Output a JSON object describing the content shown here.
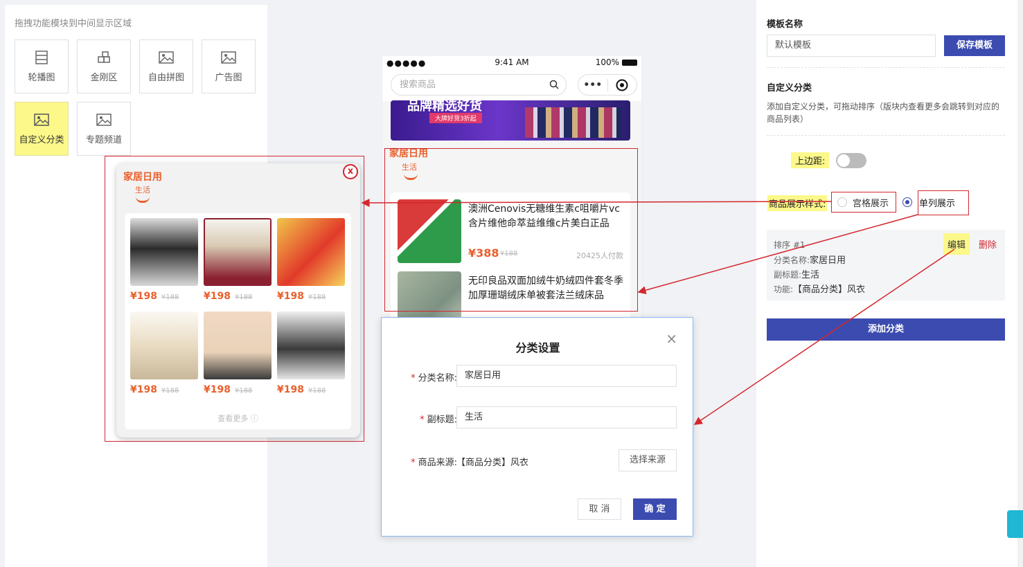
{
  "palette": {
    "hint": "拖拽功能模块到中间显示区域",
    "items": [
      {
        "label": "轮播图",
        "icon": "carousel-icon"
      },
      {
        "label": "金刚区",
        "icon": "grid-blocks-icon"
      },
      {
        "label": "自由拼图",
        "icon": "image-icon"
      },
      {
        "label": "广告图",
        "icon": "image-icon"
      },
      {
        "label": "自定义分类",
        "icon": "image-icon",
        "active": true
      },
      {
        "label": "专题频道",
        "icon": "image-icon"
      }
    ]
  },
  "phone": {
    "status": {
      "signal": "●●●●●",
      "time": "9:41 AM",
      "battery": "100%"
    },
    "search_placeholder": "搜索商品",
    "capsule_dots": "•••",
    "banner": {
      "title": "品牌精选好货",
      "subtitle": "大牌好货3折起"
    },
    "category": {
      "title": "家居日用",
      "subtitle": "生活"
    },
    "products": [
      {
        "name": "澳洲Cenovis无糖维生素c咀嚼片vc含片维他命萃益维维c片美白正品",
        "price": "¥388",
        "old_price": "¥188",
        "sold": "20425人付款"
      },
      {
        "name": "无印良品双面加绒牛奶绒四件套冬季加厚珊瑚绒床单被套法兰绒床品",
        "price": "",
        "old_price": "",
        "sold": ""
      }
    ]
  },
  "preview": {
    "title": "家居日用",
    "subtitle": "生活",
    "close": "x",
    "grid": [
      {
        "price": "¥198",
        "old": "¥188"
      },
      {
        "price": "¥198",
        "old": "¥188"
      },
      {
        "price": "¥198",
        "old": "¥188"
      },
      {
        "price": "¥198",
        "old": "¥188"
      },
      {
        "price": "¥198",
        "old": "¥188"
      },
      {
        "price": "¥198",
        "old": "¥188"
      }
    ],
    "more": "查看更多 ⓘ"
  },
  "dialog": {
    "title": "分类设置",
    "close": "×",
    "name_label": "分类名称:",
    "name_value": "家居日用",
    "subtitle_label": "副标题:",
    "subtitle_value": "生活",
    "source_label": "商品来源:",
    "source_value": "【商品分类】风衣",
    "choose_source": "选择来源",
    "cancel": "取 消",
    "confirm": "确 定",
    "required_mark": "*"
  },
  "settings": {
    "template_label": "模板名称",
    "template_value": "默认模板",
    "save": "保存模板",
    "section_title": "自定义分类",
    "section_desc": "添加自定义分类，可拖动排序（版块内查看更多会跳转到对应的商品列表）",
    "top_margin_label": "上边距:",
    "top_margin_on": false,
    "style_label": "商品展示样式:",
    "style_options": [
      "宫格展示",
      "单列展示"
    ],
    "style_selected": "单列展示",
    "sort_card": {
      "sort": "排序 #1",
      "edit": "编辑",
      "delete": "删除",
      "name_key": "分类名称:",
      "name_val": "家居日用",
      "sub_key": "副标题:",
      "sub_val": "生活",
      "func_key": "功能:",
      "func_val": "【商品分类】风衣"
    },
    "add": "添加分类"
  },
  "colors": {
    "accent": "#3b4bb0",
    "orange": "#e8602c",
    "annotation_red": "#d4262e",
    "highlight": "#fcf88a"
  }
}
